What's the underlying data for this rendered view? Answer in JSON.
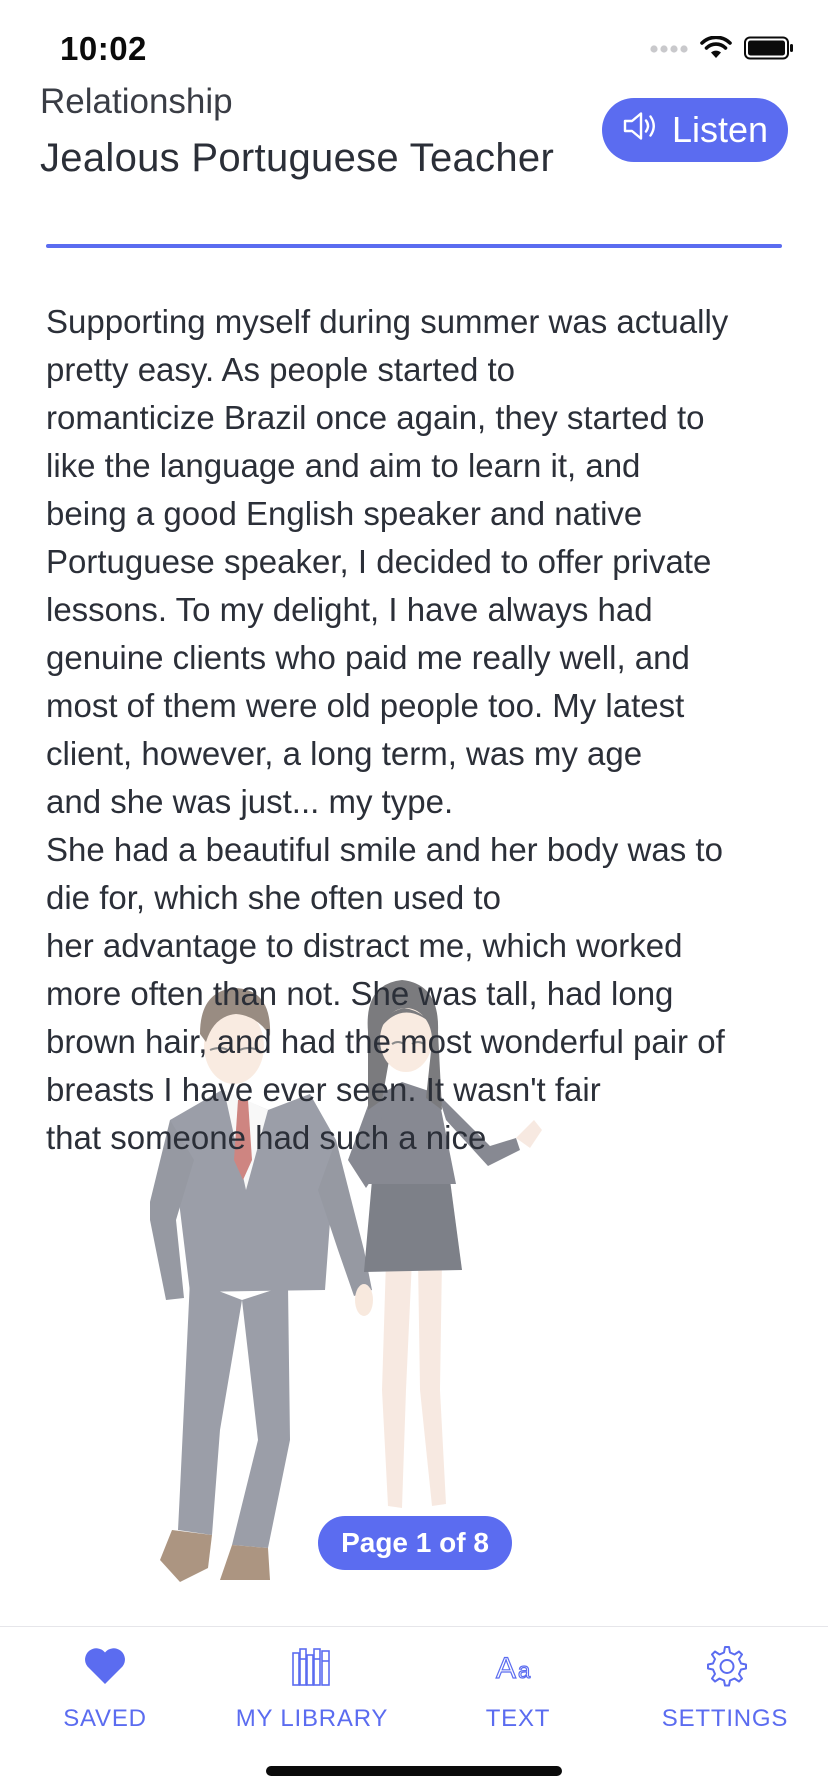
{
  "status_bar": {
    "time": "10:02"
  },
  "header": {
    "category": "Relationship",
    "title": "Jealous Portuguese Teacher",
    "listen_label": "Listen"
  },
  "story": {
    "text": "Supporting myself during summer was actually\npretty easy. As people started to\nromanticize Brazil once again, they started to\nlike the language and aim to learn it, and\nbeing a good English speaker and native\nPortuguese speaker, I decided to offer private\nlessons. To my delight, I have always had\ngenuine clients who paid me really well, and\nmost of them were old people too. My latest\nclient, however, a long term, was my age\nand she was just... my type.\nShe had a beautiful smile and her body was to\ndie for, which she often used to\nher advantage to distract me, which worked\nmore often than not. She was tall, had long\nbrown hair, and had the most wonderful pair of\nbreasts I have ever seen. It wasn't fair\nthat someone had such a nice"
  },
  "pagination": {
    "label": "Page 1 of 8",
    "current": 1,
    "total": 8
  },
  "tabs": [
    {
      "label": "SAVED",
      "icon": "heart-icon"
    },
    {
      "label": "MY LIBRARY",
      "icon": "library-books-icon"
    },
    {
      "label": "TEXT",
      "icon": "text-size-icon"
    },
    {
      "label": "SETTINGS",
      "icon": "gear-icon"
    }
  ],
  "colors": {
    "accent": "#5b6cf0",
    "text": "#2b2f38",
    "background": "#ffffff"
  }
}
